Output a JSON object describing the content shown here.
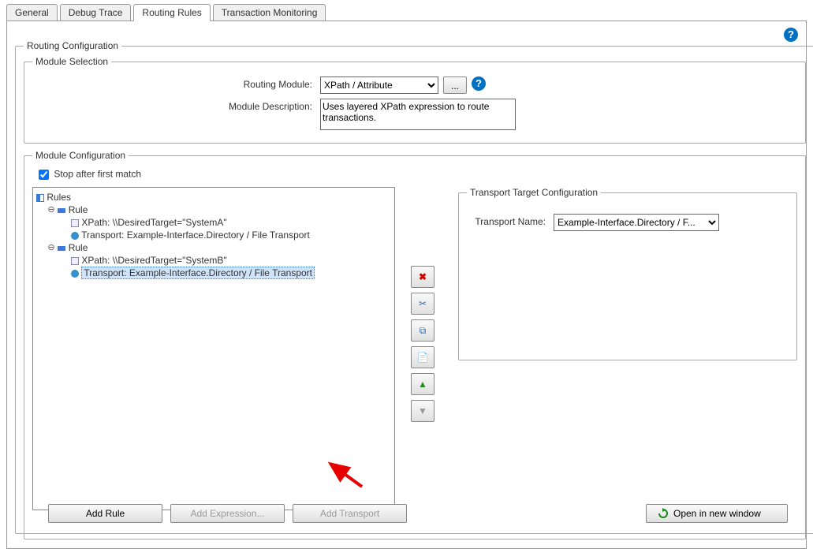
{
  "tabs": {
    "general": "General",
    "debug_trace": "Debug Trace",
    "routing_rules": "Routing Rules",
    "transaction_monitoring": "Transaction Monitoring"
  },
  "routing_configuration": {
    "legend": "Routing Configuration",
    "module_selection": {
      "legend": "Module Selection",
      "routing_module_label": "Routing Module:",
      "routing_module_value": "XPath / Attribute",
      "ellipsis": "...",
      "module_description_label": "Module Description:",
      "module_description_value": "Uses layered XPath expression to route transactions."
    },
    "module_configuration": {
      "legend": "Module Configuration",
      "stop_after_label": "Stop after first match",
      "stop_after_checked": true,
      "tree": {
        "root": "Rules",
        "rule1": {
          "label": "Rule",
          "xpath": "XPath: \\\\DesiredTarget=\"SystemA\"",
          "transport": "Transport: Example-Interface.Directory / File Transport"
        },
        "rule2": {
          "label": "Rule",
          "xpath": "XPath: \\\\DesiredTarget=\"SystemB\"",
          "transport": "Transport: Example-Interface.Directory / File Transport"
        }
      },
      "target_config": {
        "legend": "Transport Target Configuration",
        "transport_name_label": "Transport Name:",
        "transport_name_value": "Example-Interface.Directory / F..."
      },
      "buttons": {
        "add_rule": "Add Rule",
        "add_expression": "Add Expression...",
        "add_transport": "Add Transport",
        "open_window": "Open in new window"
      }
    }
  },
  "action_icons": {
    "delete": "✖",
    "cut": "✂",
    "copy": "⧉",
    "paste": "📋",
    "up": "▲",
    "down": "▼"
  }
}
